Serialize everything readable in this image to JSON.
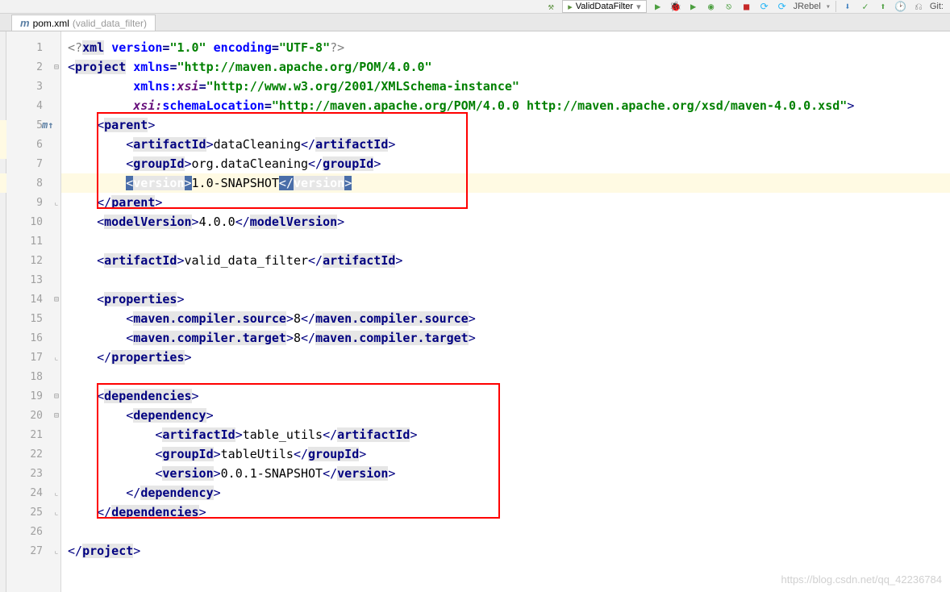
{
  "toolbar": {
    "run_config": "ValidDataFilter",
    "extra_label": "JRebel",
    "git_label": "Git:"
  },
  "tab": {
    "icon": "m",
    "name": "pom.xml",
    "context": "(valid_data_filter)"
  },
  "lines": {
    "l1": {
      "num": "1"
    },
    "l2": {
      "num": "2"
    },
    "l3": {
      "num": "3"
    },
    "l4": {
      "num": "4"
    },
    "l5": {
      "num": "5"
    },
    "l6": {
      "num": "6"
    },
    "l7": {
      "num": "7"
    },
    "l8": {
      "num": "8"
    },
    "l9": {
      "num": "9"
    },
    "l10": {
      "num": "10"
    },
    "l11": {
      "num": "11"
    },
    "l12": {
      "num": "12"
    },
    "l13": {
      "num": "13"
    },
    "l14": {
      "num": "14"
    },
    "l15": {
      "num": "15"
    },
    "l16": {
      "num": "16"
    },
    "l17": {
      "num": "17"
    },
    "l18": {
      "num": "18"
    },
    "l19": {
      "num": "19"
    },
    "l20": {
      "num": "20"
    },
    "l21": {
      "num": "21"
    },
    "l22": {
      "num": "22"
    },
    "l23": {
      "num": "23"
    },
    "l24": {
      "num": "24"
    },
    "l25": {
      "num": "25"
    },
    "l26": {
      "num": "26"
    },
    "l27": {
      "num": "27"
    }
  },
  "xml": {
    "decl_open": "<?",
    "decl_name": "xml",
    "decl_version_attr": "version",
    "decl_version_val": "\"1.0\"",
    "decl_enc_attr": "encoding",
    "decl_enc_val": "\"UTF-8\"",
    "decl_close": "?>",
    "project": "project",
    "xmlns_attr": "xmlns",
    "xmlns_val": "\"http://maven.apache.org/POM/4.0.0\"",
    "xmlns_pfx": "xmlns:",
    "xsi": "xsi",
    "xsi_val": "\"http://www.w3.org/2001/XMLSchema-instance\"",
    "xsi_pfx": "xsi:",
    "schemaloc": "schemaLocation",
    "schemaloc_val": "\"http://maven.apache.org/POM/4.0.0 http://maven.apache.org/xsd/maven-4.0.0.xsd\"",
    "parent": "parent",
    "artifactId": "artifactId",
    "groupId": "groupId",
    "version": "version",
    "modelVersion": "modelVersion",
    "properties": "properties",
    "dependencies": "dependencies",
    "dependency": "dependency",
    "mcs": "maven.compiler.source",
    "mct": "maven.compiler.target",
    "parent_artifact": "dataCleaning",
    "parent_group": "org.dataCleaning",
    "parent_version": "1.0-SNAPSHOT",
    "model_ver": "4.0.0",
    "this_artifact": "valid_data_filter",
    "java_ver": "8",
    "dep_artifact": "table_utils",
    "dep_group": "tableUtils",
    "dep_version": "0.0.1-SNAPSHOT"
  },
  "watermark": "https://blog.csdn.net/qq_42236784"
}
